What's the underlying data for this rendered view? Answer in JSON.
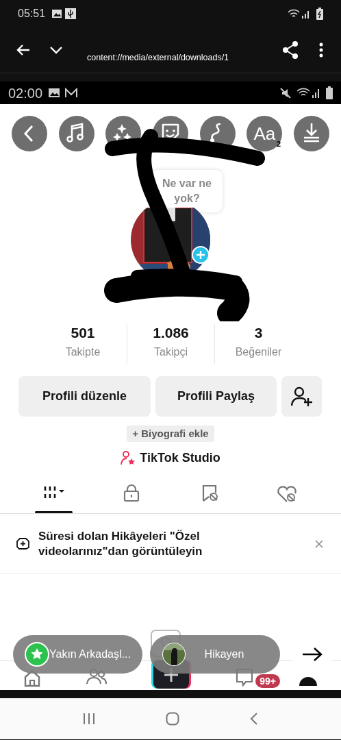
{
  "status_bar": {
    "time": "05:51"
  },
  "viewer_toolbar": {
    "url": "content://media/external/downloads/1"
  },
  "screenshot": {
    "status_bar": {
      "time": "02:00"
    },
    "editor_tools": [
      {
        "kind": "back"
      },
      {
        "kind": "music"
      },
      {
        "kind": "effects"
      },
      {
        "kind": "sticker"
      },
      {
        "kind": "draw"
      },
      {
        "kind": "text",
        "label": "Aa",
        "badge": "2"
      },
      {
        "kind": "save"
      }
    ],
    "note_bubble": "Ne var ne yok?",
    "stats": [
      {
        "value": "501",
        "label": "Takipte"
      },
      {
        "value": "1.086",
        "label": "Takipçi"
      },
      {
        "value": "3",
        "label": "Beğeniler"
      }
    ],
    "buttons": [
      "Profili düzenle",
      "Profili Paylaş"
    ],
    "bio_button": "+ Biyografi ekle",
    "studio_link": "TikTok Studio",
    "content_tabs": [
      {
        "kind": "videos",
        "selected": true
      },
      {
        "kind": "private",
        "selected": false
      },
      {
        "kind": "saved",
        "selected": false
      },
      {
        "kind": "liked",
        "selected": false
      }
    ],
    "banner": {
      "text": "Süresi dolan Hikâyeleri \"Özel videolarınız\"dan görüntüleyin"
    },
    "nav_badge": "99+",
    "share_targets": [
      {
        "kind": "close_friends",
        "label": "Yakın Arkadaşl..."
      },
      {
        "kind": "story",
        "label": "Hikayen"
      }
    ]
  }
}
